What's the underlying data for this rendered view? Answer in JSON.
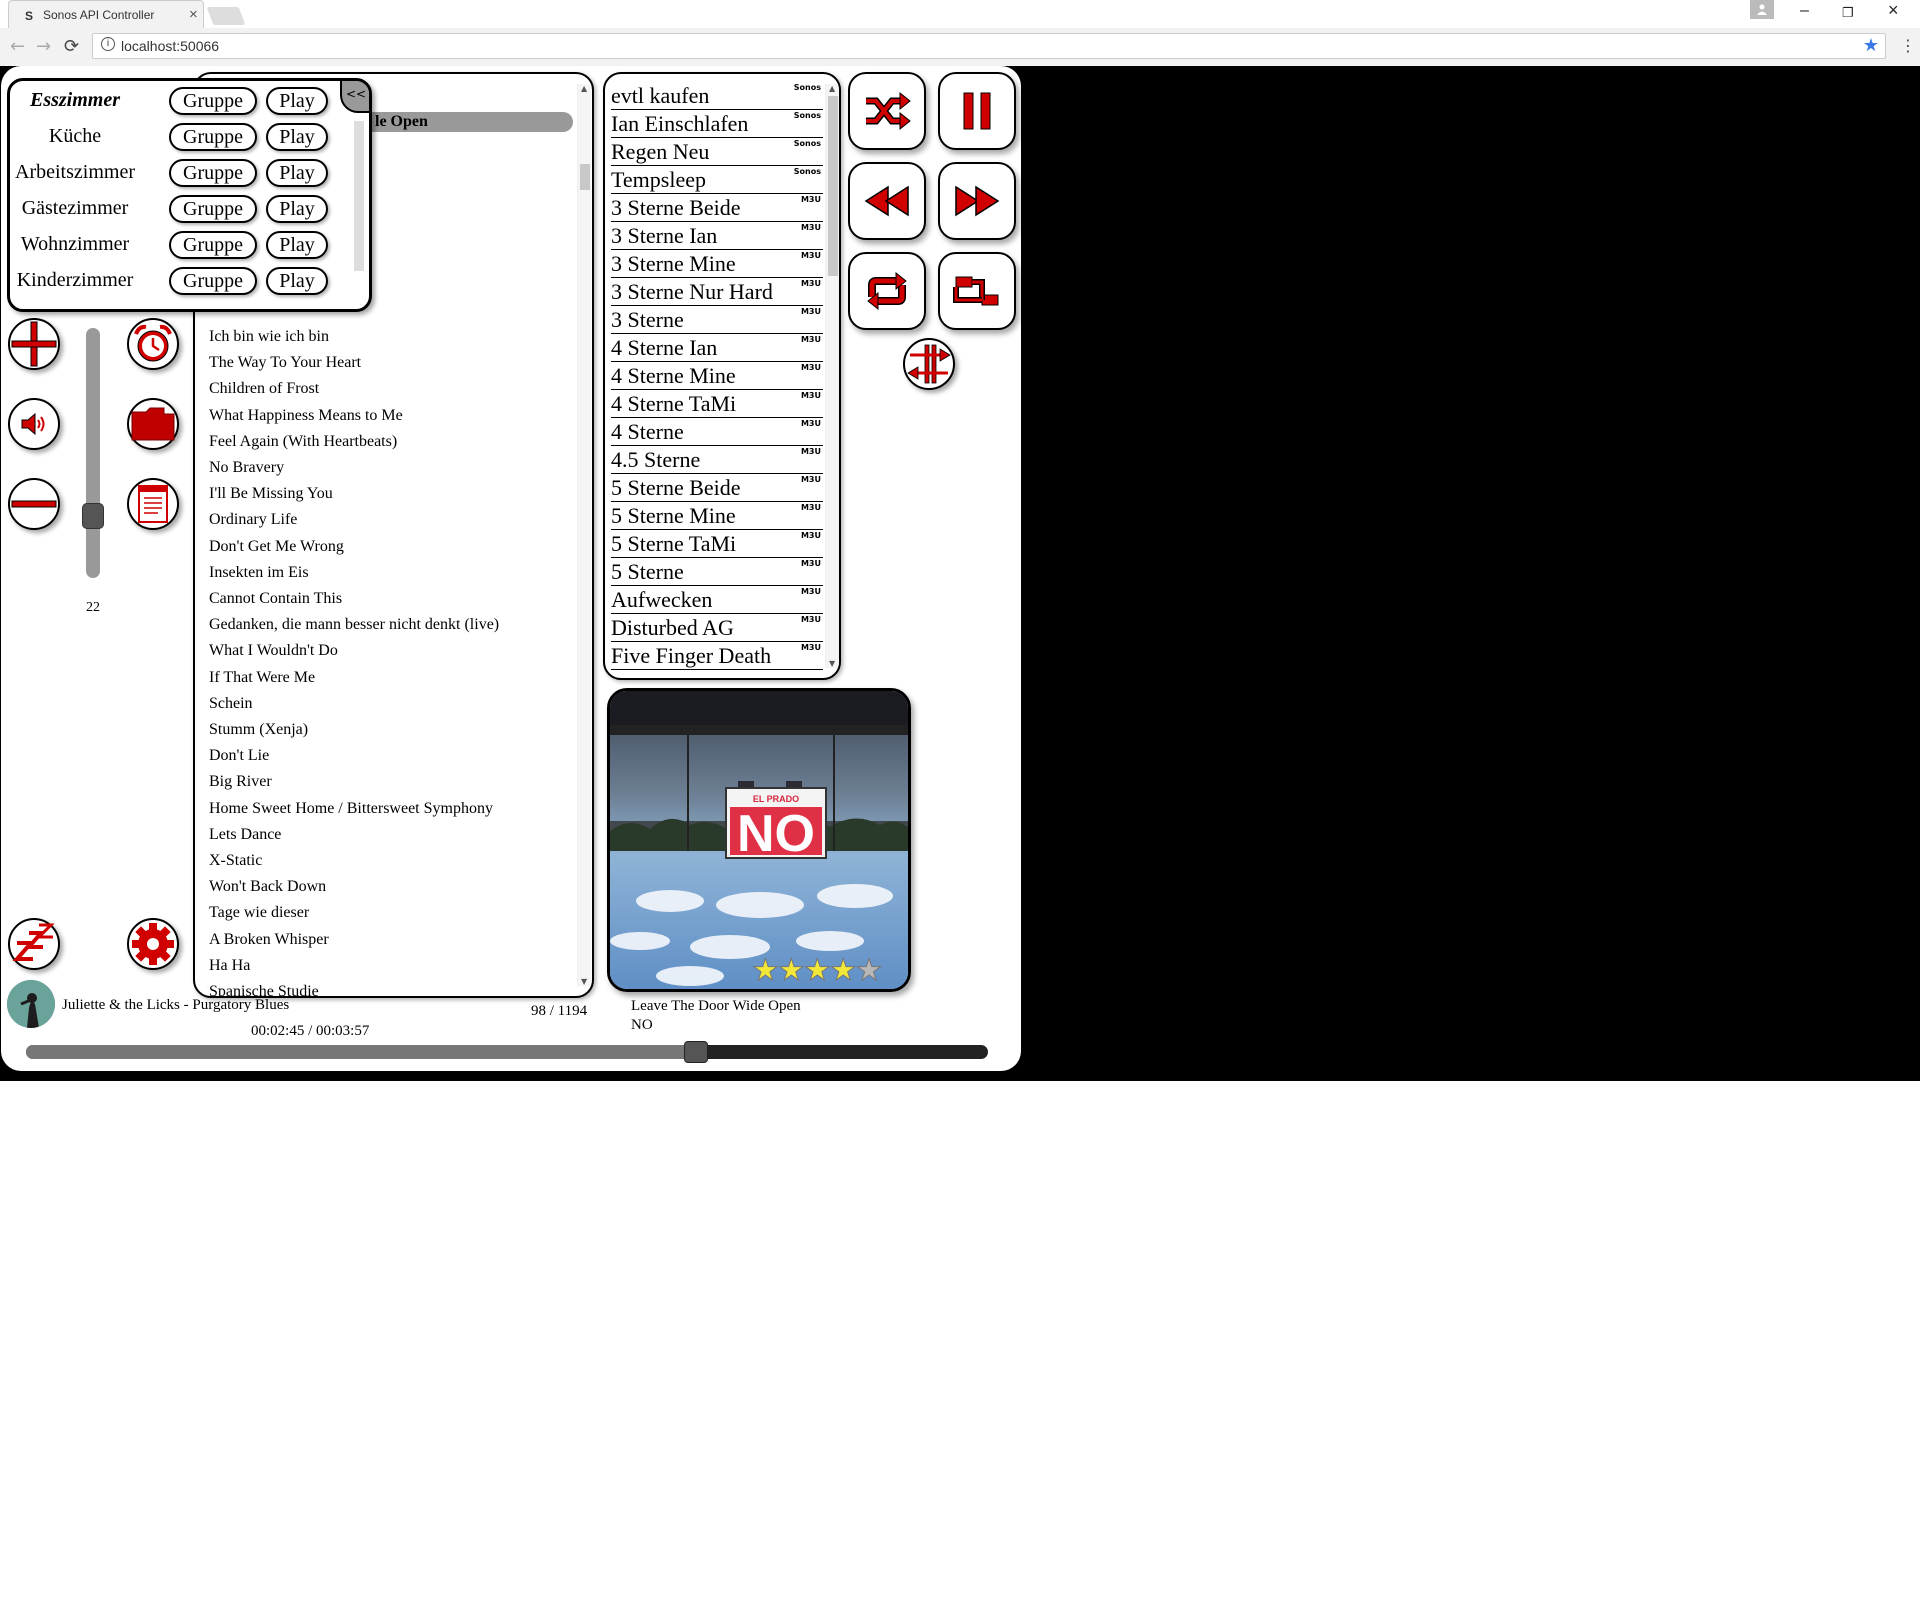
{
  "browser": {
    "tab_title": "Sonos API Controller",
    "tab_favicon": "S",
    "url": "localhost:50066"
  },
  "rooms": [
    {
      "name": "Esszimmer",
      "active": true,
      "group_label": "Gruppe",
      "play_label": "Play"
    },
    {
      "name": "Küche",
      "active": false,
      "group_label": "Gruppe",
      "play_label": "Play"
    },
    {
      "name": "Arbeitszimmer",
      "active": false,
      "group_label": "Gruppe",
      "play_label": "Play"
    },
    {
      "name": "Gästezimmer",
      "active": false,
      "group_label": "Gruppe",
      "play_label": "Play"
    },
    {
      "name": "Wohnzimmer",
      "active": false,
      "group_label": "Gruppe",
      "play_label": "Play"
    },
    {
      "name": "Kinderzimmer",
      "active": false,
      "group_label": "Gruppe",
      "play_label": "Play"
    }
  ],
  "collapse_label": "<<",
  "current_track_partial": "le Open",
  "volume": {
    "value": "22",
    "level": 0.22
  },
  "tracks": [
    "Ich bin wie ich bin",
    "The Way To Your Heart",
    "Children of Frost",
    "What Happiness Means to Me",
    "Feel Again (With Heartbeats)",
    "No Bravery",
    "I'll Be Missing You",
    "Ordinary Life",
    "Don't Get Me Wrong",
    "Insekten im Eis",
    "Cannot Contain This",
    "Gedanken, die mann besser nicht denkt (live)",
    "What I Wouldn't Do",
    "If That Were Me",
    "Schein",
    "Stumm (Xenja)",
    "Don't Lie",
    "Big River",
    "Home Sweet Home / Bittersweet Symphony",
    "Lets Dance",
    "X-Static",
    "Won't Back Down",
    "Tage wie dieser",
    "A Broken Whisper",
    "Ha Ha",
    "Spanische  Studie"
  ],
  "playlists": [
    {
      "name": "evtl kaufen",
      "tag": "Sonos"
    },
    {
      "name": "Ian Einschlafen",
      "tag": "Sonos"
    },
    {
      "name": "Regen Neu",
      "tag": "Sonos"
    },
    {
      "name": "Tempsleep",
      "tag": "Sonos"
    },
    {
      "name": "3 Sterne Beide",
      "tag": "M3U"
    },
    {
      "name": "3 Sterne Ian",
      "tag": "M3U"
    },
    {
      "name": "3 Sterne Mine",
      "tag": "M3U"
    },
    {
      "name": "3 Sterne Nur Hard",
      "tag": "M3U"
    },
    {
      "name": "3 Sterne",
      "tag": "M3U"
    },
    {
      "name": "4 Sterne Ian",
      "tag": "M3U"
    },
    {
      "name": "4 Sterne Mine",
      "tag": "M3U"
    },
    {
      "name": "4 Sterne TaMi",
      "tag": "M3U"
    },
    {
      "name": "4 Sterne",
      "tag": "M3U"
    },
    {
      "name": "4.5 Sterne",
      "tag": "M3U"
    },
    {
      "name": "5 Sterne Beide",
      "tag": "M3U"
    },
    {
      "name": "5 Sterne Mine",
      "tag": "M3U"
    },
    {
      "name": "5 Sterne TaMi",
      "tag": "M3U"
    },
    {
      "name": "5 Sterne",
      "tag": "M3U"
    },
    {
      "name": "Aufwecken",
      "tag": "M3U"
    },
    {
      "name": "Disturbed AG",
      "tag": "M3U"
    },
    {
      "name": "Five Finger Death",
      "tag": "M3U"
    }
  ],
  "cover": {
    "sign_top": "EL PRADO",
    "sign_main": "NO",
    "rating": 4,
    "rating_max": 5
  },
  "now_playing": {
    "next_artist_title": "Juliette & the Licks - Purgatory Blues",
    "position": "98 / 1194",
    "time": "00:02:45 / 00:03:57",
    "title": "Leave The Door Wide Open",
    "album": "NO",
    "progress": 0.696
  },
  "colors": {
    "accent_red": "#d00000",
    "star_gold": "#f3e73a",
    "panel_border": "#000000"
  }
}
